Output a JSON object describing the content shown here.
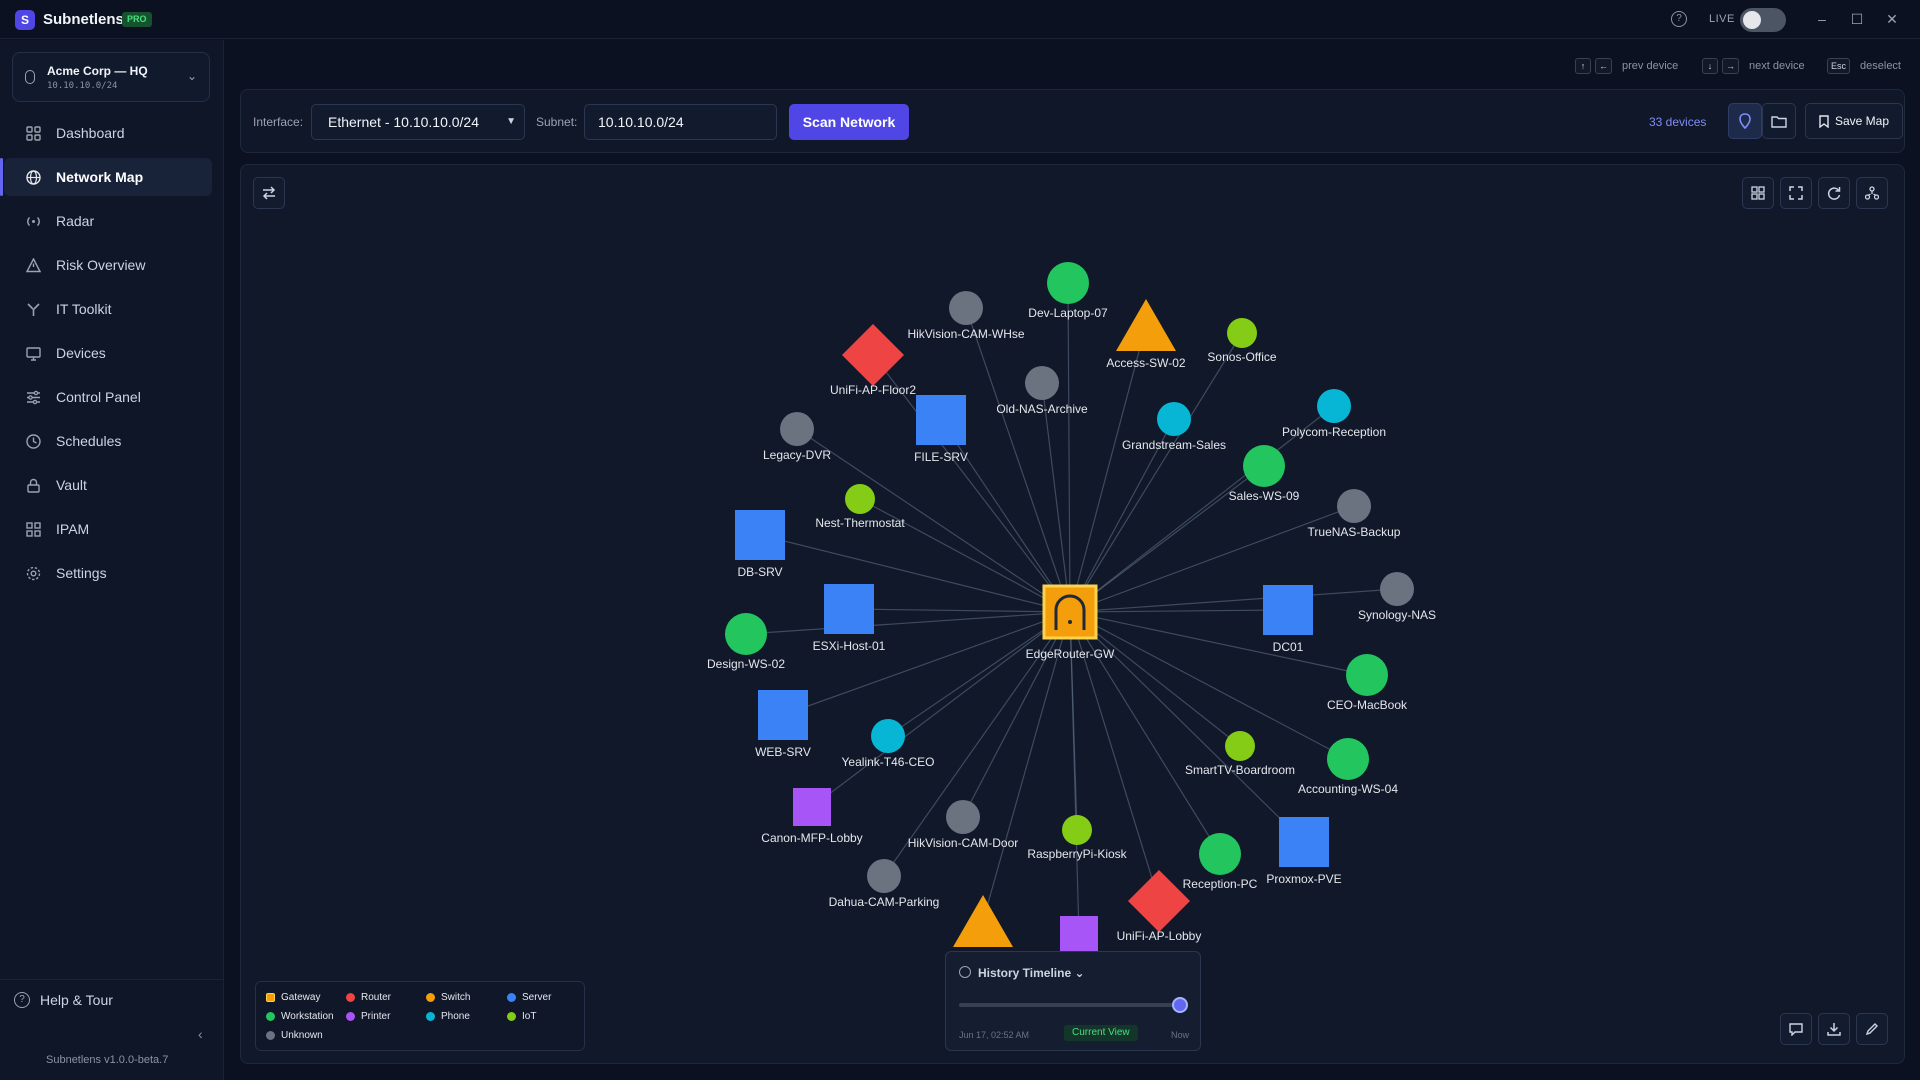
{
  "app": {
    "name": "Subnetlens",
    "badge": "PRO",
    "live_label": "LIVE"
  },
  "org": {
    "name": "Acme Corp — HQ",
    "cidr": "10.10.10.0/24"
  },
  "nav": [
    {
      "label": "Dashboard",
      "icon": "dashboard-icon",
      "active": false
    },
    {
      "label": "Network Map",
      "icon": "globe-icon",
      "active": true
    },
    {
      "label": "Radar",
      "icon": "radar-icon",
      "active": false
    },
    {
      "label": "Risk Overview",
      "icon": "warning-icon",
      "active": false
    },
    {
      "label": "IT Toolkit",
      "icon": "toolkit-icon",
      "active": false
    },
    {
      "label": "Devices",
      "icon": "monitor-icon",
      "active": false
    },
    {
      "label": "Control Panel",
      "icon": "sliders-icon",
      "active": false
    },
    {
      "label": "Schedules",
      "icon": "clock-icon",
      "active": false
    },
    {
      "label": "Vault",
      "icon": "lock-icon",
      "active": false
    },
    {
      "label": "IPAM",
      "icon": "grid-icon",
      "active": false
    },
    {
      "label": "Settings",
      "icon": "gear-icon",
      "active": false
    }
  ],
  "help_label": "Help & Tour",
  "version": "Subnetlens v1.0.0-beta.7",
  "shortcuts": {
    "prev": {
      "keys": [
        "↑",
        "←"
      ],
      "label": "prev device"
    },
    "next": {
      "keys": [
        "↓",
        "→"
      ],
      "label": "next device"
    },
    "deselect": {
      "keys": [
        "Esc"
      ],
      "label": "deselect"
    }
  },
  "toolbar": {
    "interface_label": "Interface:",
    "interface_value": "Ethernet - 10.10.10.0/24",
    "subnet_label": "Subnet:",
    "subnet_value": "10.10.10.0/24",
    "scan_label": "Scan Network",
    "device_count": "33 devices",
    "save_label": "Save Map"
  },
  "colors": {
    "gateway": "#f59e0b",
    "router": "#ef4444",
    "switch": "#f59e0b",
    "server": "#3b82f6",
    "workstation": "#22c55e",
    "printer": "#a855f7",
    "phone": "#06b6d4",
    "iot": "#84cc16",
    "unknown": "#6b7280"
  },
  "legend": [
    {
      "label": "Gateway",
      "type": "gateway"
    },
    {
      "label": "Router",
      "type": "router"
    },
    {
      "label": "Switch",
      "type": "switch"
    },
    {
      "label": "Server",
      "type": "server"
    },
    {
      "label": "Workstation",
      "type": "workstation"
    },
    {
      "label": "Printer",
      "type": "printer"
    },
    {
      "label": "Phone",
      "type": "phone"
    },
    {
      "label": "IoT",
      "type": "iot"
    },
    {
      "label": "Unknown",
      "type": "unknown"
    }
  ],
  "timeline": {
    "title": "History Timeline",
    "start": "Jun 17, 02:52 AM",
    "current": "Current View",
    "end": "Now"
  },
  "gateway": {
    "label": "EdgeRouter-GW"
  },
  "devices": [
    {
      "label": "Dev-Laptop-07",
      "type": "workstation"
    },
    {
      "label": "HikVision-CAM-WHse",
      "type": "unknown"
    },
    {
      "label": "Access-SW-02",
      "type": "switch"
    },
    {
      "label": "Sonos-Office",
      "type": "iot"
    },
    {
      "label": "UniFi-AP-Floor2",
      "type": "router"
    },
    {
      "label": "Old-NAS-Archive",
      "type": "unknown"
    },
    {
      "label": "FILE-SRV",
      "type": "server"
    },
    {
      "label": "Polycom-Reception",
      "type": "phone"
    },
    {
      "label": "Legacy-DVR",
      "type": "unknown"
    },
    {
      "label": "Grandstream-Sales",
      "type": "phone"
    },
    {
      "label": "Sales-WS-09",
      "type": "workstation"
    },
    {
      "label": "Nest-Thermostat",
      "type": "iot"
    },
    {
      "label": "TrueNAS-Backup",
      "type": "unknown"
    },
    {
      "label": "DB-SRV",
      "type": "server"
    },
    {
      "label": "ESXi-Host-01",
      "type": "server"
    },
    {
      "label": "Synology-NAS",
      "type": "unknown"
    },
    {
      "label": "DC01",
      "type": "server"
    },
    {
      "label": "Design-WS-02",
      "type": "workstation"
    },
    {
      "label": "CEO-MacBook",
      "type": "workstation"
    },
    {
      "label": "WEB-SRV",
      "type": "server"
    },
    {
      "label": "Yealink-T46-CEO",
      "type": "phone"
    },
    {
      "label": "SmartTV-Boardroom",
      "type": "iot"
    },
    {
      "label": "Accounting-WS-04",
      "type": "workstation"
    },
    {
      "label": "Canon-MFP-Lobby",
      "type": "printer"
    },
    {
      "label": "HikVision-CAM-Door",
      "type": "unknown"
    },
    {
      "label": "RaspberryPi-Kiosk",
      "type": "iot"
    },
    {
      "label": "Proxmox-PVE",
      "type": "server"
    },
    {
      "label": "Reception-PC",
      "type": "workstation"
    },
    {
      "label": "Dahua-CAM-Parking",
      "type": "unknown"
    },
    {
      "label": "UniFi-AP-Lobby",
      "type": "router"
    },
    {
      "label": "",
      "type": "switch"
    },
    {
      "label": "",
      "type": "printer"
    }
  ]
}
